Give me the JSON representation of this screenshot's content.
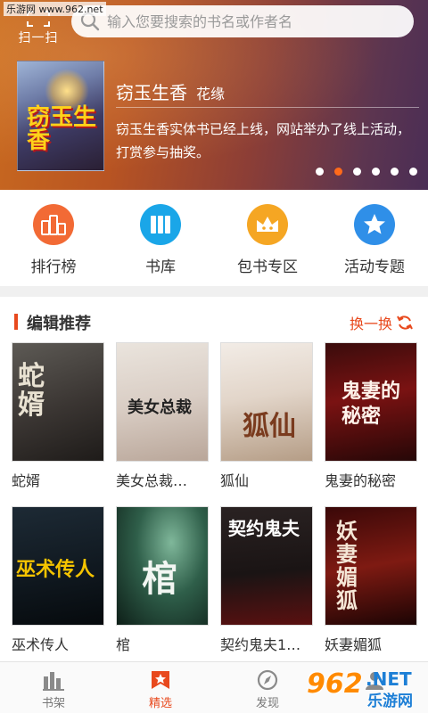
{
  "watermark": "乐游网 www.962.net",
  "header": {
    "scan_label": "扫一扫",
    "search_placeholder": "输入您要搜索的书名或作者名"
  },
  "featured": {
    "cover_text": "窃玉生香",
    "title": "窃玉生香",
    "author": "花缘",
    "description": "窃玉生香实体书已经上线，网站举办了线上活动，打赏参与抽奖。",
    "carousel_total": 6,
    "carousel_active": 2
  },
  "categories": [
    {
      "label": "排行榜",
      "icon": "ranking-icon",
      "color": "#f26a35"
    },
    {
      "label": "书库",
      "icon": "library-icon",
      "color": "#1aa6e8"
    },
    {
      "label": "包书专区",
      "icon": "crown-icon",
      "color": "#f5a623"
    },
    {
      "label": "活动专题",
      "icon": "star-activity-icon",
      "color": "#2f8fe8"
    }
  ],
  "editor_picks": {
    "title": "编辑推荐",
    "refresh_label": "换一换",
    "books": [
      {
        "title": "蛇婿",
        "cover_text": "蛇婿"
      },
      {
        "title": "美女总裁…",
        "cover_text": "美女总裁"
      },
      {
        "title": "狐仙",
        "cover_text": "狐仙"
      },
      {
        "title": "鬼妻的秘密",
        "cover_text": "鬼妻的秘密"
      },
      {
        "title": "巫术传人",
        "cover_text": "巫术传人"
      },
      {
        "title": "棺",
        "cover_text": "棺"
      },
      {
        "title": "契约鬼夫1…",
        "cover_text": "契约鬼夫"
      },
      {
        "title": "妖妻媚狐",
        "cover_text": "妖妻媚狐"
      }
    ]
  },
  "nav": [
    {
      "label": "书架",
      "icon": "bookshelf-icon"
    },
    {
      "label": "精选",
      "icon": "featured-icon",
      "active": true
    },
    {
      "label": "发现",
      "icon": "discover-icon"
    },
    {
      "label": "",
      "icon": "profile-icon"
    }
  ],
  "logo": {
    "num": "962",
    "net": ".NET",
    "cn": "乐游网"
  }
}
